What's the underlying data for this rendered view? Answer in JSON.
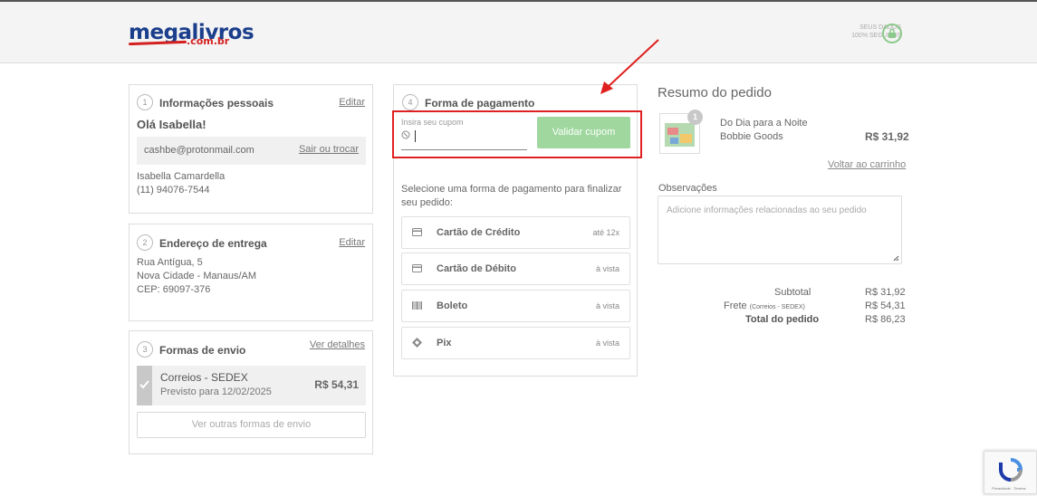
{
  "header": {
    "logo_main": "megalivros",
    "logo_sub": ".com.br",
    "secure_line1": "SEUS DADOS",
    "secure_line2": "100% SEGUROS"
  },
  "personal": {
    "step": "1",
    "title": "Informações pessoais",
    "edit_label": "Editar",
    "greeting": "Olá Isabella!",
    "email": "cashbe@protonmail.com",
    "logout_label": "Sair ou trocar",
    "name": "Isabella Camardella",
    "phone": "(11) 94076-7544"
  },
  "address": {
    "step": "2",
    "title": "Endereço de entrega",
    "edit_label": "Editar",
    "line1": "Rua Antígua, 5",
    "line2": "Nova Cidade - Manaus/AM",
    "line3": "CEP: 69097-376"
  },
  "shipping": {
    "step": "3",
    "title": "Formas de envio",
    "details_label": "Ver detalhes",
    "option_name": "Correios - SEDEX",
    "option_eta": "Previsto para 12/02/2025",
    "option_price": "R$ 54,31",
    "other_button": "Ver outras formas de envio"
  },
  "payment": {
    "step": "4",
    "title": "Forma de pagamento",
    "coupon_label": "Insira seu cupom",
    "coupon_value": "",
    "validate_button": "Validar cupom",
    "instructions": "Selecione uma forma de pagamento para finalizar seu pedido:",
    "options": [
      {
        "label": "Cartão de Crédito",
        "aux": "até 12x",
        "icon": "credit-card-icon"
      },
      {
        "label": "Cartão de Débito",
        "aux": "à vista",
        "icon": "debit-card-icon"
      },
      {
        "label": "Boleto",
        "aux": "à vista",
        "icon": "barcode-icon"
      },
      {
        "label": "Pix",
        "aux": "à vista",
        "icon": "pix-icon"
      }
    ]
  },
  "summary": {
    "title": "Resumo do pedido",
    "item_qty": "1",
    "item_name": "Do Dia para a Noite",
    "item_author": "Bobbie Goods",
    "item_price": "R$ 31,92",
    "back_link": "Voltar ao carrinho",
    "notes_label": "Observações",
    "notes_placeholder": "Adicione informações relacionadas ao seu pedido",
    "subtotal_label": "Subtotal",
    "subtotal_value": "R$ 31,92",
    "freight_label": "Frete",
    "freight_detail": "(Correios - SEDEX)",
    "freight_value": "R$ 54,31",
    "total_label": "Total do pedido",
    "total_value": "R$ 86,23"
  },
  "recaptcha": {
    "text": "Privacidade - Termos"
  },
  "colors": {
    "accent_green": "#9fd79f",
    "annotation_red": "#e02020",
    "brand_blue": "#1b3f8c"
  }
}
